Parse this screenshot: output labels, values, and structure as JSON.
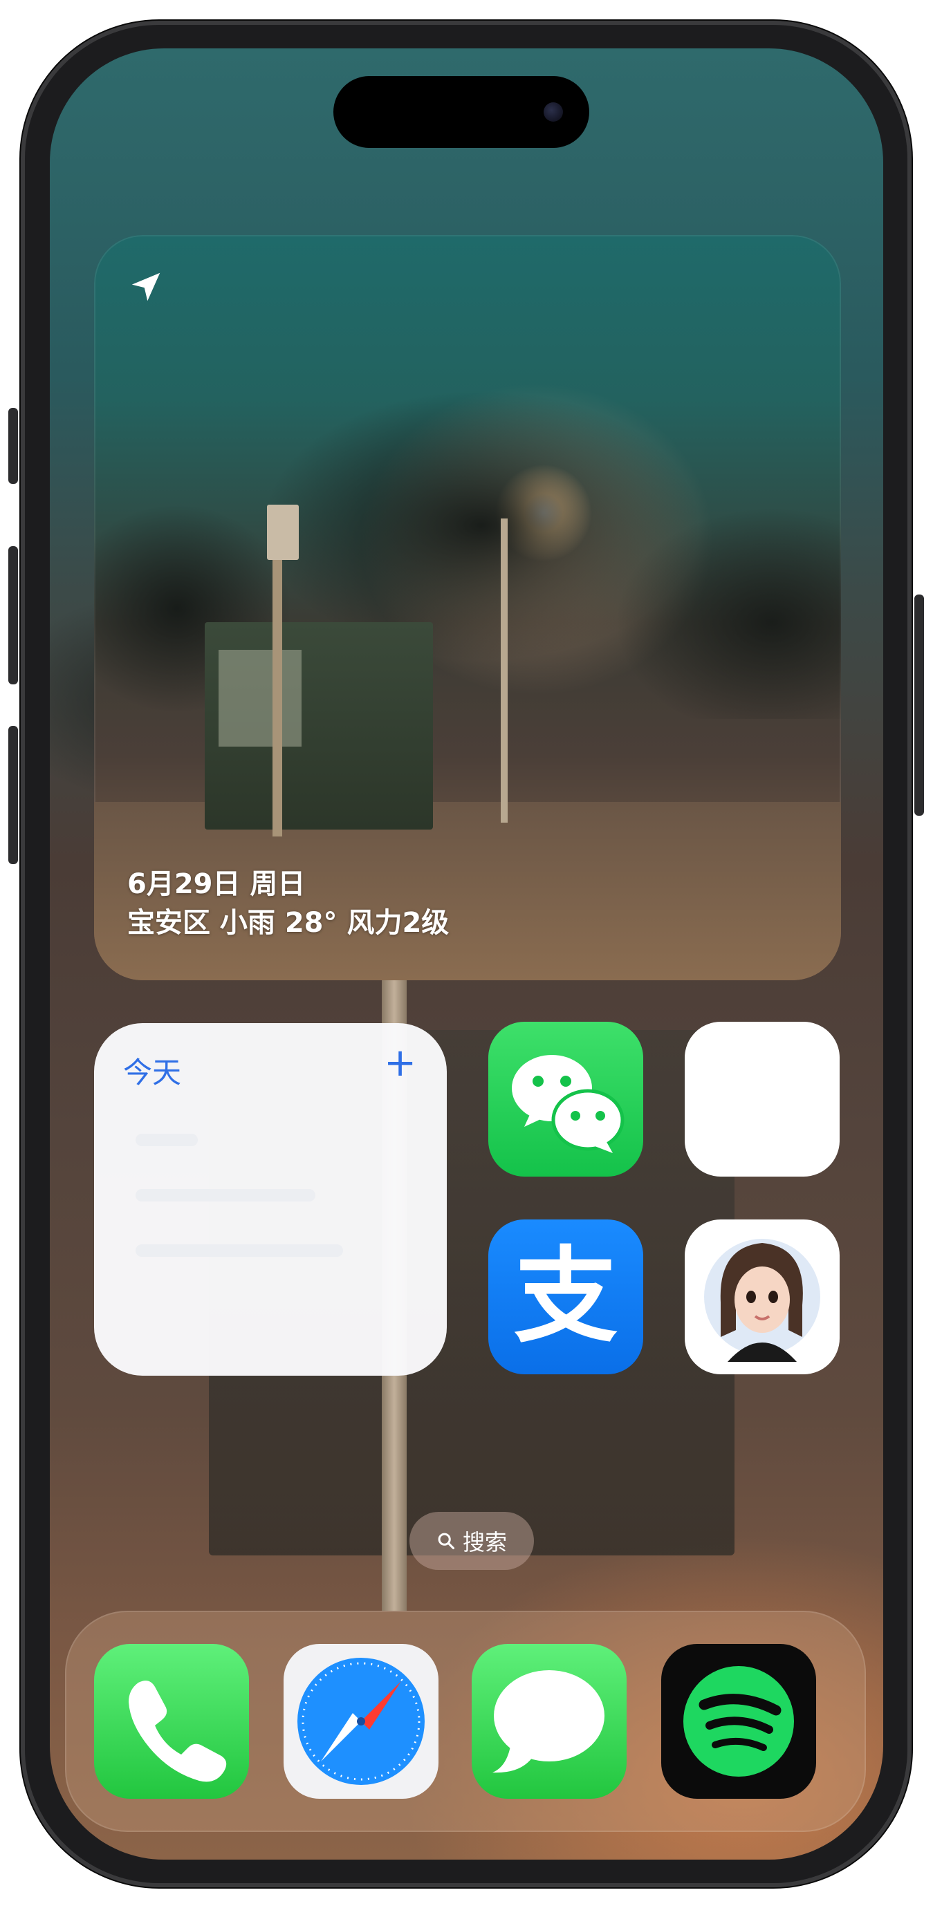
{
  "photo_widget": {
    "date": "6月29日 周日",
    "weather": "宝安区 小雨 28° 风力2级",
    "icon": "location-arrow-icon"
  },
  "reminders_widget": {
    "title": "今天",
    "add_icon": "plus-icon"
  },
  "apps": [
    {
      "name": "WeChat",
      "icon": "wechat-icon"
    },
    {
      "name": "",
      "icon": "blank-app-icon"
    },
    {
      "name": "Alipay",
      "icon": "alipay-icon",
      "glyph": "支"
    },
    {
      "name": "",
      "icon": "avatar-app-icon"
    }
  ],
  "search": {
    "label": "搜索",
    "icon": "search-icon"
  },
  "dock": [
    {
      "icon": "phone-icon"
    },
    {
      "icon": "safari-compass-icon"
    },
    {
      "icon": "messages-icon"
    },
    {
      "icon": "spotify-icon"
    }
  ],
  "colors": {
    "accent_blue": "#2f6fe6",
    "wechat_green": "#14c24a",
    "alipay_blue": "#0a6fe8",
    "spotify_green": "#1ed760"
  }
}
